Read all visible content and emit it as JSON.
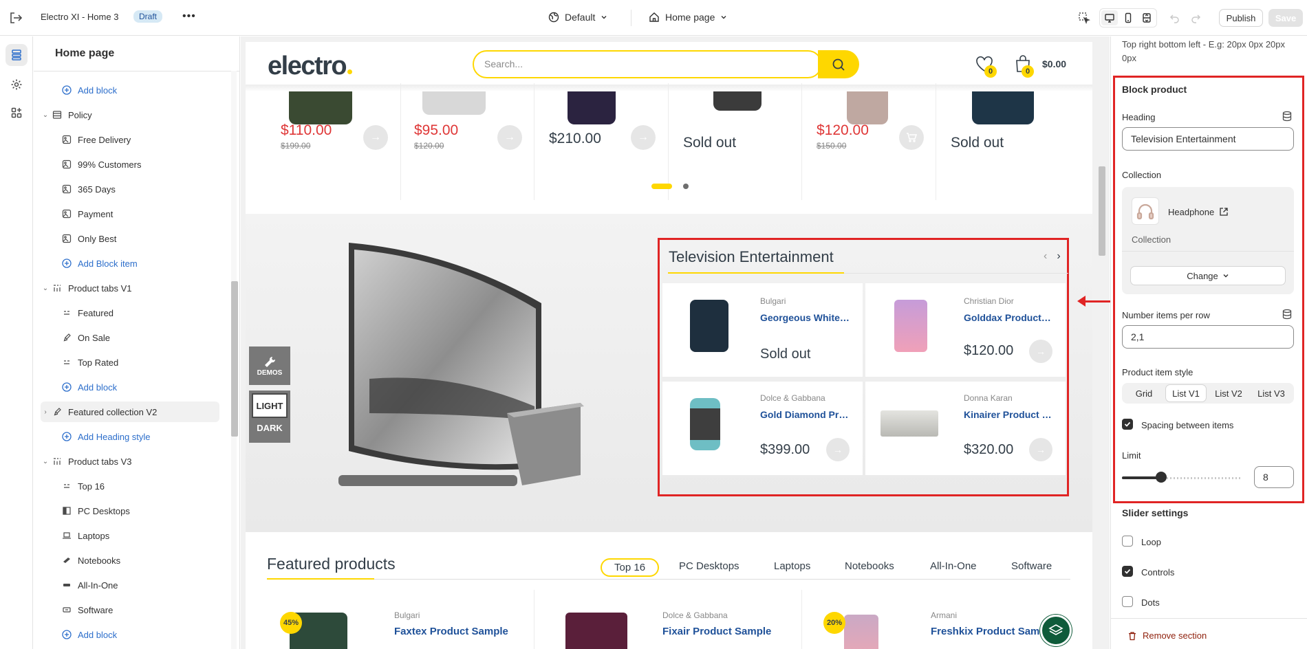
{
  "topbar": {
    "title": "Electro XI - Home 3",
    "badge": "Draft",
    "more": "•••",
    "theme_label": "Default",
    "page_label": "Home page",
    "publish": "Publish",
    "save": "Save"
  },
  "sidebar": {
    "title": "Home page",
    "items": [
      {
        "label": "Add block"
      },
      {
        "label": "Policy"
      },
      {
        "label": "Free Delivery"
      },
      {
        "label": "99% Customers"
      },
      {
        "label": "365 Days"
      },
      {
        "label": "Payment"
      },
      {
        "label": "Only Best"
      },
      {
        "label": "Add Block item"
      },
      {
        "label": "Product tabs V1"
      },
      {
        "label": "Featured"
      },
      {
        "label": "On Sale"
      },
      {
        "label": "Top Rated"
      },
      {
        "label": "Add block"
      },
      {
        "label": "Featured collection V2"
      },
      {
        "label": "Add Heading style"
      },
      {
        "label": "Product tabs V3"
      },
      {
        "label": "Top 16"
      },
      {
        "label": "PC Desktops"
      },
      {
        "label": "Laptops"
      },
      {
        "label": "Notebooks"
      },
      {
        "label": "All-In-One"
      },
      {
        "label": "Software"
      },
      {
        "label": "Add block"
      }
    ]
  },
  "store": {
    "logo": "electro",
    "search_placeholder": "Search...",
    "wishlist_count": "0",
    "cart_count": "0",
    "cart_total": "$0.00",
    "top_products": [
      {
        "price": "$110.00",
        "old": "$199.00"
      },
      {
        "price": "$95.00",
        "old": "$120.00"
      },
      {
        "price": "$210.00"
      },
      {
        "price": "Sold out"
      },
      {
        "price": "$120.00",
        "old": "$150.00"
      },
      {
        "price": "Sold out"
      }
    ],
    "demos": "DEMOS",
    "light": "LIGHT",
    "dark": "DARK",
    "tv": {
      "title": "Television Entertainment",
      "products": [
        {
          "brand": "Bulgari",
          "name": "Georgeous White Product Sample",
          "price": "Sold out"
        },
        {
          "brand": "Christian Dior",
          "name": "Golddax Product Sample",
          "price": "$120.00"
        },
        {
          "brand": "Dolce & Gabbana",
          "name": "Gold Diamond Product Sample",
          "price": "$399.00"
        },
        {
          "brand": "Donna Karan",
          "name": "Kinairer Product Sample",
          "price": "$320.00"
        }
      ]
    },
    "featured": {
      "title": "Featured products",
      "tabs": [
        "Top 16",
        "PC Desktops",
        "Laptops",
        "Notebooks",
        "All-In-One",
        "Software"
      ],
      "products": [
        {
          "badge": "45%",
          "brand": "Bulgari",
          "name": "Faxtex Product Sample"
        },
        {
          "brand": "Dolce & Gabbana",
          "name": "Fixair Product Sample"
        },
        {
          "badge": "20%",
          "brand": "Armani",
          "name": "Freshkix Product Sample"
        }
      ]
    }
  },
  "panel": {
    "padding_hint": "Top right bottom left - E.g: 20px 0px 20px 0px",
    "block_title": "Block product",
    "heading_label": "Heading",
    "heading_value": "Television Entertainment",
    "collection_label": "Collection",
    "collection_name": "Headphone",
    "collection_sub": "Collection",
    "change": "Change",
    "per_row_label": "Number items per row",
    "per_row_value": "2,1",
    "style_label": "Product item style",
    "style_options": [
      "Grid",
      "List V1",
      "List V2",
      "List V3"
    ],
    "spacing_label": "Spacing between items",
    "limit_label": "Limit",
    "limit_value": "8",
    "limit_fraction": 0.33,
    "slider_title": "Slider settings",
    "loop": "Loop",
    "controls": "Controls",
    "dots": "Dots",
    "remove": "Remove section"
  },
  "colors": {
    "accent": "#fed700",
    "highlight": "#e02424",
    "link": "#1f5199",
    "sale": "#df3737"
  }
}
